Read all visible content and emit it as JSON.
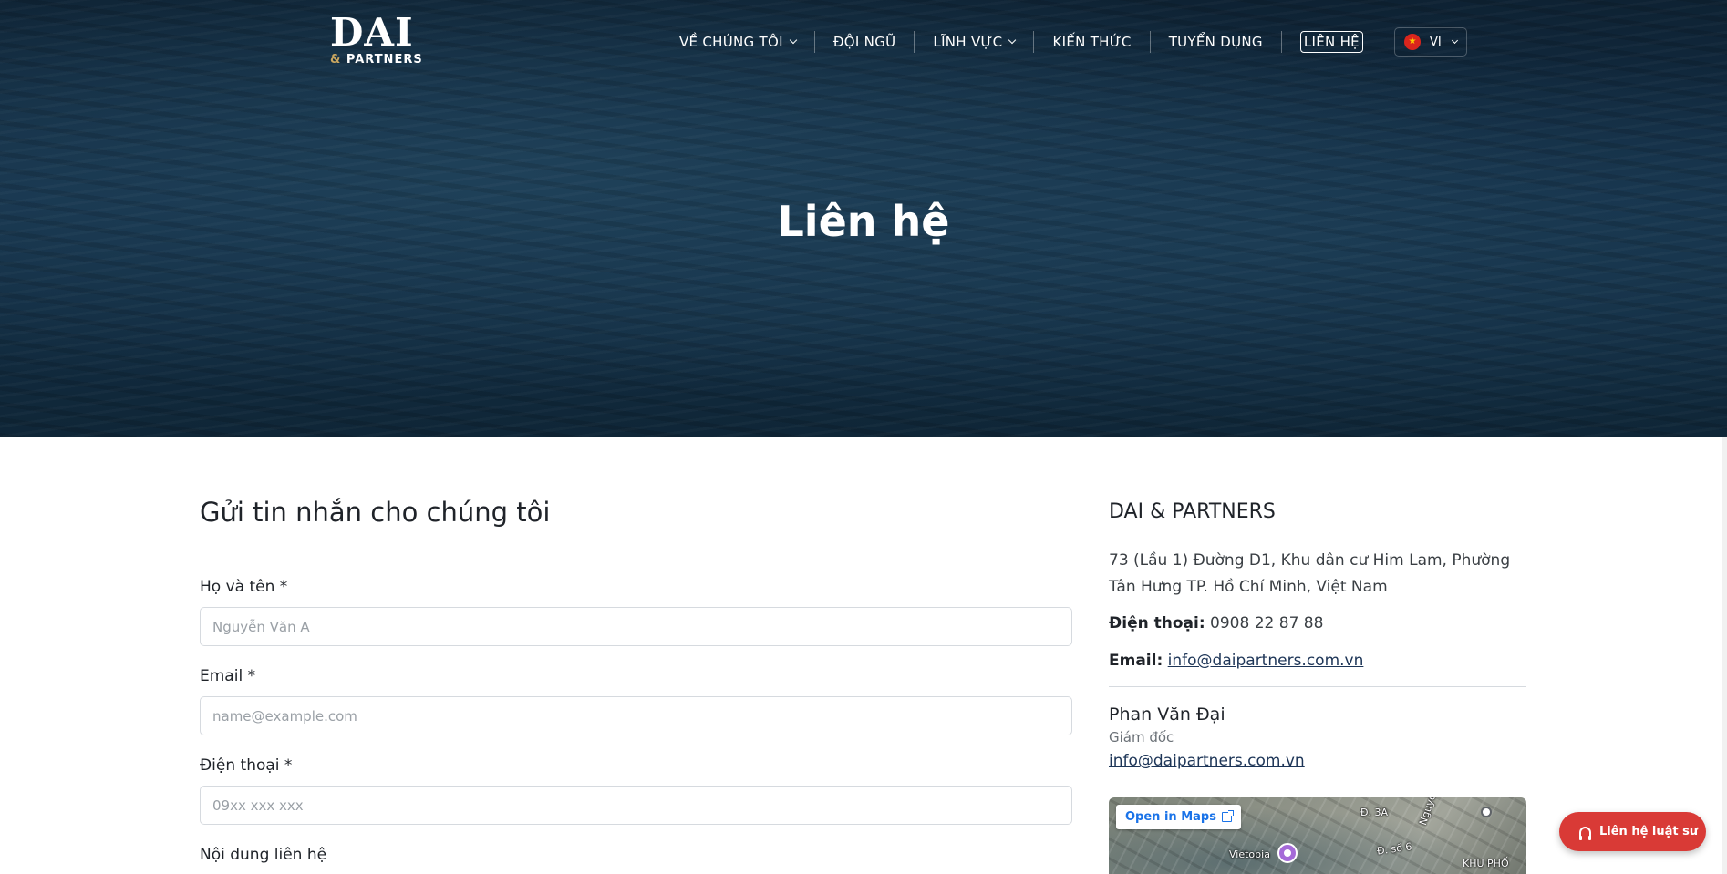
{
  "header": {
    "logo_main": "DAI",
    "logo_amp": "&",
    "logo_sub": " PARTNERS",
    "nav": [
      {
        "label": "VỀ CHÚNG TÔI"
      },
      {
        "label": "ĐỘI NGŨ"
      },
      {
        "label": "LĨNH VỰC"
      },
      {
        "label": "KIẾN THỨC"
      },
      {
        "label": "TUYỂN DỤNG"
      },
      {
        "label": "LIÊN HỆ"
      }
    ],
    "language": "VI",
    "icons": {
      "flag": "vietnam-flag-icon",
      "chevron": "chevron-down-icon"
    }
  },
  "hero": {
    "title": "Liên hệ"
  },
  "form": {
    "heading": "Gửi tin nhắn cho chúng tôi",
    "name_label": "Họ và tên *",
    "name_placeholder": "Nguyễn Văn A",
    "email_label": "Email *",
    "email_placeholder": "name@example.com",
    "phone_label": "Điện thoại *",
    "phone_placeholder": "09xx xxx xxx",
    "message_label": "Nội dung liên hệ"
  },
  "contact": {
    "company": "DAI & PARTNERS",
    "address": "73 (Lầu 1) Đường D1, Khu dân cư Him Lam, Phường Tân Hưng TP. Hồ Chí Minh, Việt Nam",
    "phone_label": "Điện thoại:",
    "phone_value": "0908 22 87 88",
    "email_label": "Email:",
    "email_value": "info@daipartners.com.vn",
    "person_name": "Phan Văn Đại",
    "person_title": "Giám đốc",
    "person_email": "info@daipartners.com.vn"
  },
  "map": {
    "open_label": "Open in Maps",
    "labels": [
      "Đ. 3A",
      "Đ. số 6",
      "Vietopia",
      "KHU PHỐ",
      "Nguyễn Hữu"
    ]
  },
  "cta": {
    "label": "Liên hệ luật sư",
    "icon": "headset-icon"
  },
  "colors": {
    "cta": "#d93a36",
    "link": "#1d3557",
    "hero": "#15314a"
  }
}
